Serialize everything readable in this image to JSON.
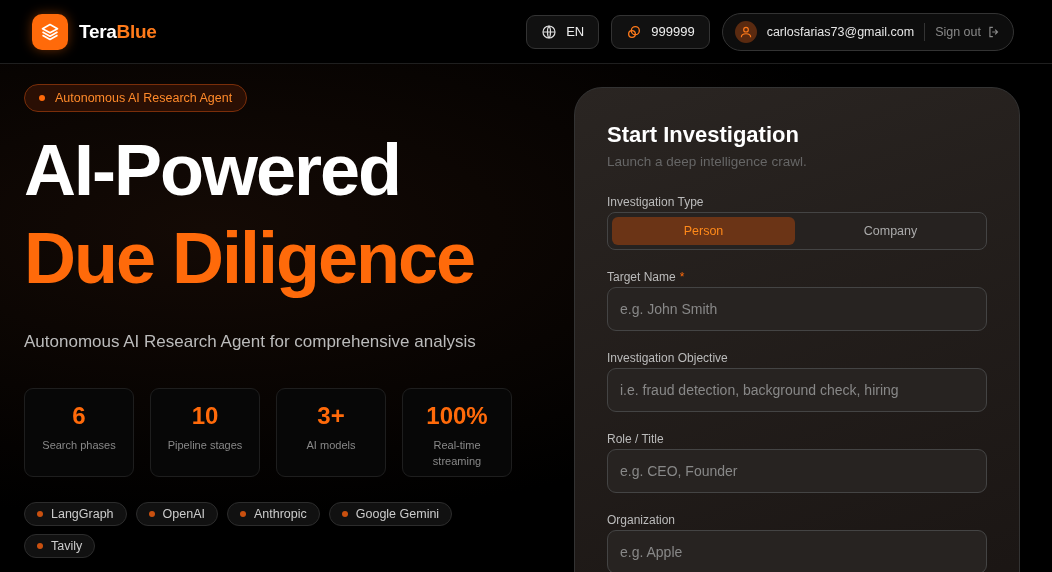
{
  "header": {
    "brand": {
      "part_1": "Tera",
      "part_2": "Blue"
    },
    "language": "EN",
    "credits": "999999",
    "email": "carlosfarias73@gmail.com",
    "sign_out": "Sign out"
  },
  "hero": {
    "badge": "Autonomous AI Research Agent",
    "title_line_1": "AI-Powered",
    "title_line_2": "Due Diligence",
    "subtitle": "Autonomous AI Research Agent for comprehensive analysis",
    "stats": [
      {
        "value": "6",
        "label": "Search phases"
      },
      {
        "value": "10",
        "label": "Pipeline stages"
      },
      {
        "value": "3+",
        "label": "AI models"
      },
      {
        "value": "100%",
        "label": "Real-time streaming"
      }
    ],
    "tags": [
      "LangGraph",
      "OpenAI",
      "Anthropic",
      "Google Gemini",
      "Tavily"
    ]
  },
  "form": {
    "title": "Start Investigation",
    "subtitle": "Launch a deep intelligence crawl.",
    "type_label": "Investigation Type",
    "types": [
      {
        "label": "Person",
        "selected": true
      },
      {
        "label": "Company",
        "selected": false
      }
    ],
    "fields": [
      {
        "label": "Target Name",
        "required_mark": "*",
        "placeholder": "e.g. John Smith"
      },
      {
        "label": "Investigation Objective",
        "placeholder": "i.e. fraud detection, background check, hiring"
      },
      {
        "label": "Role / Title",
        "placeholder": "e.g. CEO, Founder"
      },
      {
        "label": "Organization",
        "placeholder": "e.g. Apple"
      }
    ]
  }
}
